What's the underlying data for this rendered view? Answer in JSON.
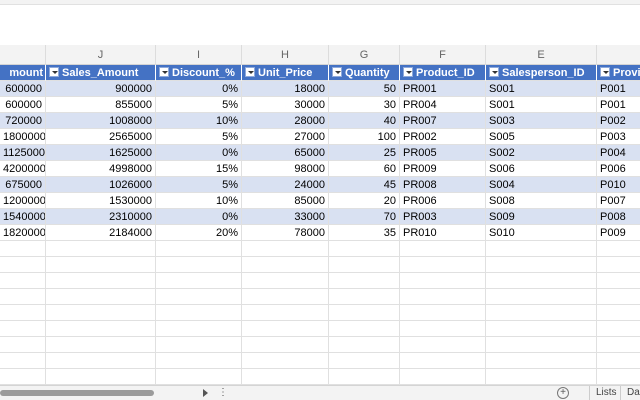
{
  "columns": [
    {
      "letter": "J"
    },
    {
      "letter": "I"
    },
    {
      "letter": "H"
    },
    {
      "letter": "G"
    },
    {
      "letter": "F"
    },
    {
      "letter": "E"
    }
  ],
  "headers": [
    "mount",
    "Sales_Amount",
    "Discount_%",
    "Unit_Price",
    "Quantity",
    "Product_ID",
    "Salesperson_ID",
    "Provi"
  ],
  "rows": [
    [
      "600000",
      "900000",
      "0%",
      "18000",
      "50",
      "PR001",
      "S001",
      "P001"
    ],
    [
      "600000",
      "855000",
      "5%",
      "30000",
      "30",
      "PR004",
      "S001",
      "P001"
    ],
    [
      "720000",
      "1008000",
      "10%",
      "28000",
      "40",
      "PR007",
      "S003",
      "P002"
    ],
    [
      "1800000",
      "2565000",
      "5%",
      "27000",
      "100",
      "PR002",
      "S005",
      "P003"
    ],
    [
      "1125000",
      "1625000",
      "0%",
      "65000",
      "25",
      "PR005",
      "S002",
      "P004"
    ],
    [
      "4200000",
      "4998000",
      "15%",
      "98000",
      "60",
      "PR009",
      "S006",
      "P006"
    ],
    [
      "675000",
      "1026000",
      "5%",
      "24000",
      "45",
      "PR008",
      "S004",
      "P010"
    ],
    [
      "1200000",
      "1530000",
      "10%",
      "85000",
      "20",
      "PR006",
      "S008",
      "P007"
    ],
    [
      "1540000",
      "2310000",
      "0%",
      "33000",
      "70",
      "PR003",
      "S009",
      "P008"
    ],
    [
      "1820000",
      "2184000",
      "20%",
      "78000",
      "35",
      "PR010",
      "S010",
      "P009"
    ]
  ],
  "footer": {
    "add_sheet": "+",
    "tabs": [
      "Lists",
      "Das"
    ]
  }
}
